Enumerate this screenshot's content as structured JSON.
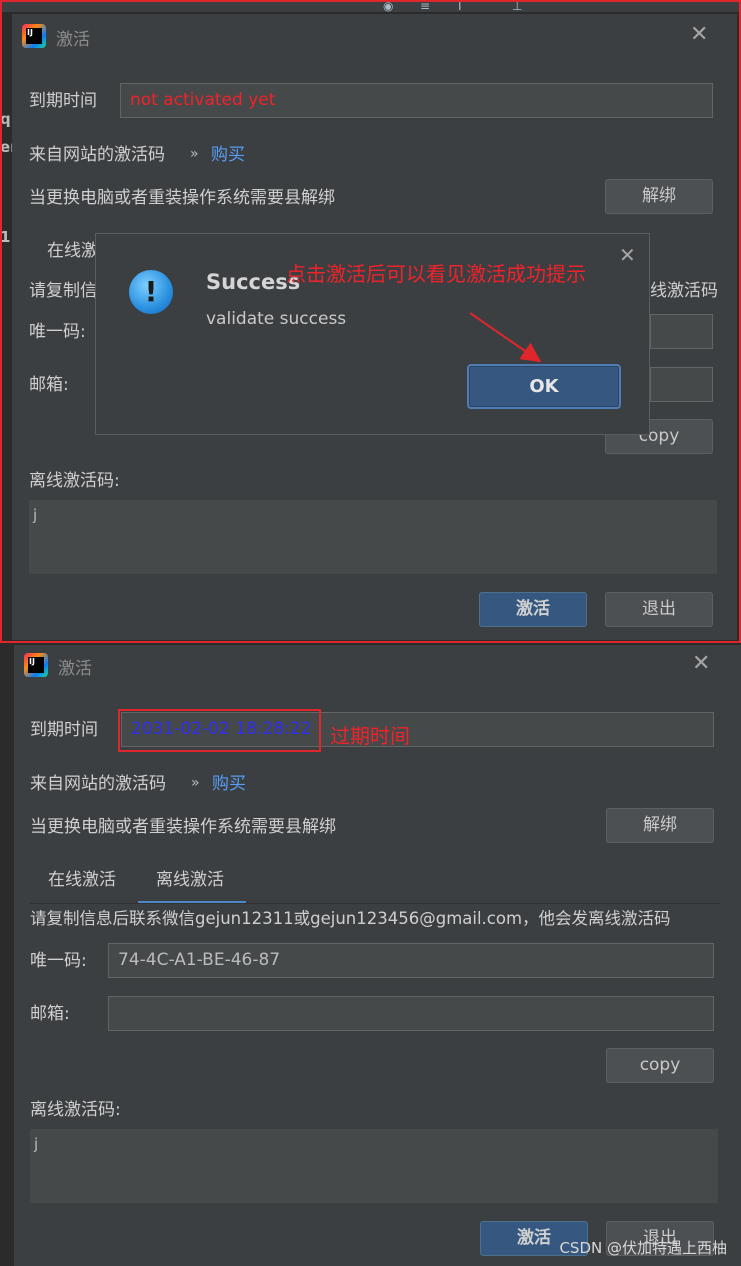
{
  "dialog_top": {
    "title": "激活",
    "expire_label": "到期时间",
    "expire_value": "not activated yet",
    "website_label": "来自网站的激活码",
    "buy_link": "购买",
    "unbind_text": "当更换电脑或者重装操作系统需要县解绑",
    "unbind_button": "解绑",
    "tab_online_partial": "在线激",
    "copy_info_partial": "请复制信",
    "copy_info_right": "线激活码",
    "id_label": "唯一码:",
    "email_label": "邮箱:",
    "copy_button": "copy",
    "offline_code_label": "离线激活码:",
    "offline_code_value": "j",
    "activate_button": "激活",
    "exit_button": "退出"
  },
  "popup": {
    "title": "Success",
    "message": "validate success",
    "ok_button": "OK",
    "annotation": "点击激活后可以看见激活成功提示"
  },
  "dialog_bottom": {
    "title": "激活",
    "expire_label": "到期时间",
    "expire_value": "2031-02-02 18:28:22",
    "expire_annotation": "过期时间",
    "website_label": "来自网站的激活码",
    "buy_link": "购买",
    "unbind_text": "当更换电脑或者重装操作系统需要县解绑",
    "unbind_button": "解绑",
    "tabs": [
      "在线激活",
      "离线激活"
    ],
    "copy_info": "请复制信息后联系微信gejun12311或gejun123456@gmail.com，他会发离线激活码",
    "id_label": "唯一码:",
    "id_value": "74-4C-A1-BE-46-87",
    "email_label": "邮箱:",
    "copy_button": "copy",
    "offline_code_label": "离线激活码:",
    "offline_code_value": "j",
    "activate_button": "激活",
    "exit_button": "退出"
  },
  "background": {
    "left_edge_chars": [
      "q",
      "er",
      "1"
    ]
  },
  "watermark": "CSDN @伏加特遇上西柚",
  "colors": {
    "dialog_bg": "#3c3f41",
    "field_bg": "#45494a",
    "primary_button": "#365880",
    "link": "#589df6",
    "annotation_red": "#f0222a",
    "expire_blue": "#2f2ff0"
  }
}
